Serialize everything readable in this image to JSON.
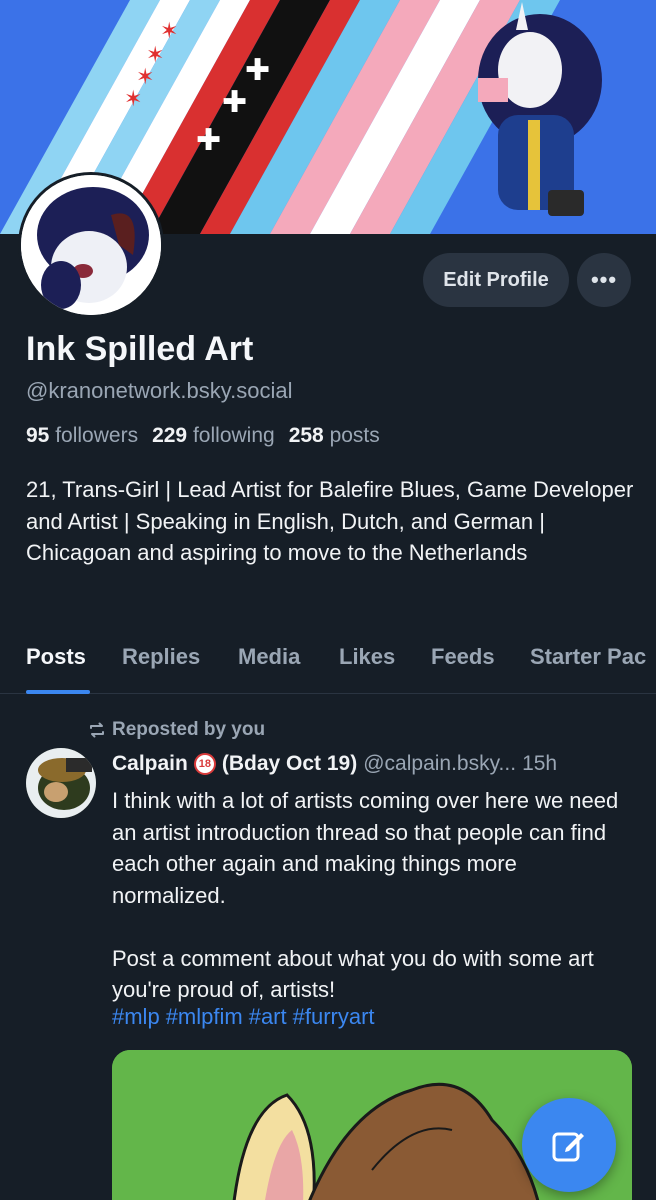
{
  "profile": {
    "display_name": "Ink Spilled Art",
    "handle": "@kranonetwork.bsky.social",
    "followers_count": "95",
    "followers_label": "followers",
    "following_count": "229",
    "following_label": "following",
    "posts_count": "258",
    "posts_label": "posts",
    "bio": "21, Trans-Girl | Lead Artist for Balefire Blues, Game Developer and Artist | Speaking in English, Dutch, and German | Chicagoan and aspiring to move to the Netherlands"
  },
  "actions": {
    "edit_label": "Edit Profile",
    "more_label": "•••"
  },
  "tabs": [
    {
      "label": "Posts"
    },
    {
      "label": "Replies"
    },
    {
      "label": "Media"
    },
    {
      "label": "Likes"
    },
    {
      "label": "Feeds"
    },
    {
      "label": "Starter Pac"
    }
  ],
  "post": {
    "repost_label": "Reposted by you",
    "author": "Calpain",
    "badge": "18",
    "author_suffix": "(Bday Oct 19)",
    "handle": "@calpain.bsky...",
    "time": "15h",
    "text": "I think with a lot of artists coming over here we need an artist introduction thread so that people can find each other again and making things more normalized.\n\nPost a comment about what you do with some art you're proud of, artists!",
    "hashtags": [
      "#mlp",
      "#mlpfim",
      "#art",
      "#furryart"
    ]
  },
  "colors": {
    "background": "#161e27",
    "accent": "#3b87f0",
    "button_bg": "#2a3441",
    "muted_text": "#9aa6b4"
  },
  "icons": {
    "repost": "repost-icon",
    "compose": "compose-icon",
    "more": "more-icon"
  }
}
